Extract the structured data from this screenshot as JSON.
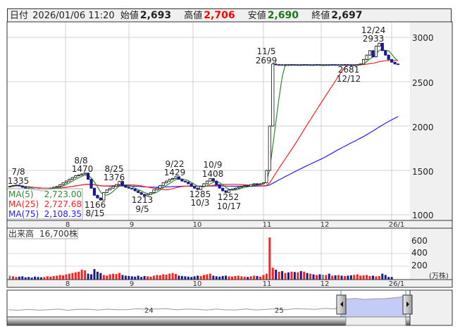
{
  "header": {
    "date_label": "日付",
    "datetime": "2026/01/06 11:20",
    "open_label": "始値",
    "open": "2,693",
    "high_label": "高値",
    "high": "2,706",
    "low_label": "安値",
    "low": "2,690",
    "close_label": "終値",
    "close": "2,697"
  },
  "colors": {
    "up": "#ffffff",
    "down": "#1a1a8c",
    "ma5": "#2e8b2e",
    "ma25": "#ff2020",
    "ma75": "#2020ff",
    "high": "#ff0000",
    "low": "#1a7a1a",
    "vol_up": "#ff2020",
    "vol_down": "#1a1a8c",
    "vol_flat": "#888888"
  },
  "legend": {
    "ma5_label": "MA(5)",
    "ma5_value": "2,723.00",
    "ma25_label": "MA(25)",
    "ma25_value": "2,727.68",
    "ma75_label": "MA(75)",
    "ma75_value": "2,108.35"
  },
  "annotations": [
    {
      "date": "7/8",
      "value": "1335"
    },
    {
      "date": "8/8",
      "value": "1470"
    },
    {
      "date": "8/15",
      "value": "1166"
    },
    {
      "date": "8/25",
      "value": "1376"
    },
    {
      "date": "9/5",
      "value": "1213"
    },
    {
      "date": "9/22",
      "value": "1429"
    },
    {
      "date": "10/3",
      "value": "1285"
    },
    {
      "date": "10/9",
      "value": "1408"
    },
    {
      "date": "10/17",
      "value": "1252"
    },
    {
      "date": "11/5",
      "value": "2699"
    },
    {
      "date": "12/12",
      "value": "2681"
    },
    {
      "date": "12/24",
      "value": "2933"
    }
  ],
  "price_axis": [
    "3000",
    "2500",
    "2000",
    "1500",
    "1000"
  ],
  "month_axis": [
    "8",
    "9",
    "10",
    "11",
    "12",
    "26/1"
  ],
  "volume": {
    "label": "出来高",
    "value": "16,700株",
    "axis": [
      "600",
      "400",
      "200"
    ],
    "unit": "(万株)"
  },
  "navigator": {
    "year_labels": [
      "24",
      "25"
    ]
  },
  "chart_data": {
    "type": "candlestick",
    "price_range": [
      1000,
      3000
    ],
    "closes": [
      1320,
      1330,
      1335,
      1325,
      1310,
      1300,
      1290,
      1285,
      1280,
      1275,
      1270,
      1280,
      1290,
      1300,
      1310,
      1320,
      1340,
      1360,
      1380,
      1400,
      1420,
      1440,
      1450,
      1460,
      1470,
      1400,
      1300,
      1220,
      1190,
      1166,
      1250,
      1280,
      1300,
      1320,
      1340,
      1376,
      1330,
      1310,
      1300,
      1290,
      1270,
      1250,
      1230,
      1213,
      1230,
      1250,
      1280,
      1300,
      1330,
      1360,
      1380,
      1400,
      1410,
      1429,
      1400,
      1380,
      1370,
      1350,
      1320,
      1300,
      1285,
      1320,
      1350,
      1380,
      1408,
      1380,
      1340,
      1300,
      1270,
      1252,
      1280,
      1290,
      1300,
      1310,
      1320,
      1330,
      1320,
      1340,
      1350,
      1340,
      1350,
      1360,
      1500,
      2000,
      2699,
      2690,
      2692,
      2690,
      2691,
      2690,
      2692,
      2690,
      2691,
      2690,
      2692,
      2690,
      2691,
      2690,
      2692,
      2690,
      2690,
      2691,
      2690,
      2692,
      2690,
      2691,
      2690,
      2692,
      2690,
      2681,
      2690,
      2692,
      2700,
      2750,
      2800,
      2850,
      2780,
      2900,
      2933,
      2850,
      2800,
      2750,
      2720,
      2700,
      2697
    ],
    "volumes_man": [
      60,
      50,
      40,
      45,
      50,
      35,
      40,
      30,
      45,
      40,
      35,
      40,
      50,
      45,
      55,
      60,
      70,
      65,
      80,
      90,
      100,
      110,
      120,
      150,
      140,
      90,
      80,
      160,
      120,
      100,
      70,
      60,
      80,
      90,
      85,
      100,
      70,
      60,
      55,
      50,
      45,
      60,
      40,
      55,
      50,
      45,
      60,
      70,
      65,
      80,
      75,
      90,
      100,
      85,
      60,
      55,
      50,
      45,
      40,
      50,
      60,
      55,
      70,
      80,
      90,
      60,
      50,
      45,
      55,
      60,
      50,
      45,
      55,
      60,
      50,
      45,
      40,
      50,
      60,
      55,
      45,
      70,
      90,
      640,
      180,
      150,
      120,
      130,
      100,
      110,
      120,
      115,
      110,
      130,
      120,
      100,
      90,
      80,
      70,
      80,
      75,
      70,
      90,
      60,
      65,
      70,
      60,
      55,
      60,
      65,
      70,
      80,
      60,
      65,
      70,
      55,
      60,
      50,
      55,
      90,
      70,
      40,
      40
    ],
    "navigator_series": [
      1420,
      1410,
      1400,
      1405,
      1420,
      1430,
      1425,
      1440,
      1450,
      1445,
      1430,
      1440,
      1460,
      1470,
      1510,
      1500,
      1480,
      1470,
      1460,
      1450,
      1440,
      1430,
      1420,
      1430,
      1440,
      1450,
      1460,
      1470,
      1480,
      1490,
      1500,
      1520,
      1510,
      1530,
      2690,
      2690,
      2700,
      2690,
      2700,
      2900,
      2920
    ]
  }
}
